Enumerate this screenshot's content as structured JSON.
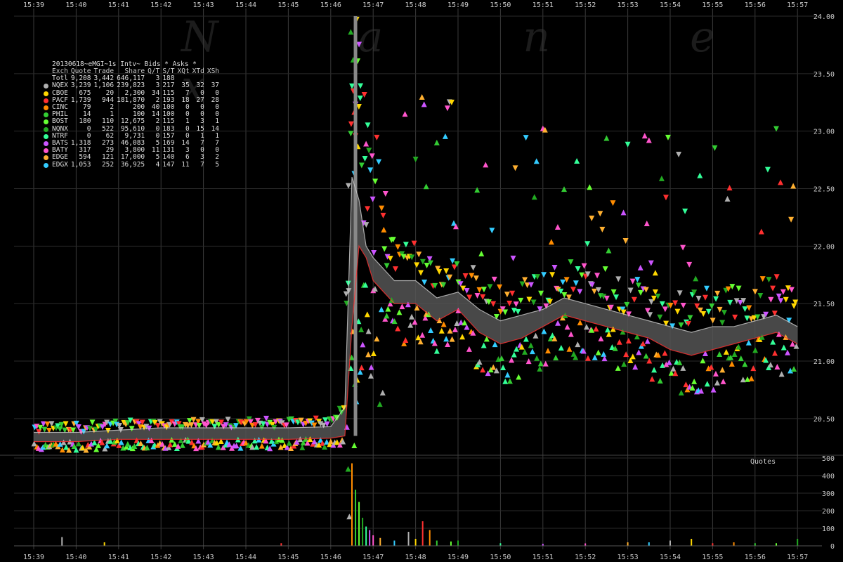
{
  "chart_data": [
    {
      "type": "scatter",
      "title": "20130618~eMGI~1s Intv~ Bids * Asks *",
      "watermark": "N a n e x",
      "x_ticks": [
        "15:39",
        "15:40",
        "15:41",
        "15:42",
        "15:43",
        "15:44",
        "15:45",
        "15:46",
        "15:47",
        "15:48",
        "15:49",
        "15:50",
        "15:51",
        "15:52",
        "15:53",
        "15:54",
        "15:55",
        "15:56",
        "15:57"
      ],
      "y_ticks": [
        "24.00",
        "23.50",
        "23.00",
        "22.50",
        "22.00",
        "21.50",
        "21.00",
        "20.50"
      ],
      "ylim": [
        20.2,
        24.0
      ],
      "grid": true,
      "colors": {
        "NQEX": "#b0b0b0",
        "CBOE": "#ffd700",
        "PACF": "#ff3030",
        "CINC": "#ff8c00",
        "PHIL": "#33cc33",
        "BOST": "#66ff33",
        "NQNX": "#22aa22",
        "NTRF": "#33ff99",
        "BATS": "#cc55ff",
        "BATY": "#ff55cc",
        "EDGE": "#ffb030",
        "EDGX": "#33ccff",
        "nbbo": "#555555"
      },
      "legend": {
        "columns": [
          "Exch",
          "Quote",
          "Trade",
          "Share",
          "Q/T",
          "S/T",
          "XQt",
          "XTd",
          "XSh"
        ],
        "rows": [
          {
            "name": "Totl",
            "color": "",
            "values": [
              "9,208",
              "3,442",
              "646,117",
              "3",
              "188",
              "",
              "",
              ""
            ]
          },
          {
            "name": "NQEX",
            "color": "#b0b0b0",
            "values": [
              "3,239",
              "1,106",
              "239,823",
              "3",
              "217",
              "35",
              "32",
              "37"
            ]
          },
          {
            "name": "CBOE",
            "color": "#ffd700",
            "values": [
              "675",
              "20",
              "2,300",
              "34",
              "115",
              "7",
              "0",
              "0"
            ]
          },
          {
            "name": "PACF",
            "color": "#ff3030",
            "values": [
              "1,739",
              "944",
              "181,870",
              "2",
              "193",
              "18",
              "27",
              "28"
            ]
          },
          {
            "name": "CINC",
            "color": "#ff8c00",
            "values": [
              "79",
              "2",
              "200",
              "40",
              "100",
              "0",
              "0",
              "0"
            ]
          },
          {
            "name": "PHIL",
            "color": "#33cc33",
            "values": [
              "14",
              "1",
              "100",
              "14",
              "100",
              "0",
              "0",
              "0"
            ]
          },
          {
            "name": "BOST",
            "color": "#66ff33",
            "values": [
              "180",
              "110",
              "12,675",
              "2",
              "115",
              "1",
              "3",
              "1"
            ]
          },
          {
            "name": "NQNX",
            "color": "#22aa22",
            "values": [
              "0",
              "522",
              "95,610",
              "0",
              "183",
              "0",
              "15",
              "14"
            ]
          },
          {
            "name": "NTRF",
            "color": "#33ff99",
            "values": [
              "0",
              "62",
              "9,731",
              "0",
              "157",
              "0",
              "1",
              "1"
            ]
          },
          {
            "name": "BATS",
            "color": "#cc55ff",
            "values": [
              "1,318",
              "273",
              "46,083",
              "5",
              "169",
              "14",
              "7",
              "7"
            ]
          },
          {
            "name": "BATY",
            "color": "#ff55cc",
            "values": [
              "317",
              "29",
              "3,800",
              "11",
              "131",
              "3",
              "0",
              "0"
            ]
          },
          {
            "name": "EDGE",
            "color": "#ffb030",
            "values": [
              "594",
              "121",
              "17,000",
              "5",
              "140",
              "6",
              "3",
              "2"
            ]
          },
          {
            "name": "EDGX",
            "color": "#33ccff",
            "values": [
              "1,053",
              "252",
              "36,925",
              "4",
              "147",
              "11",
              "7",
              "5"
            ]
          }
        ]
      },
      "price_path": {
        "x": [
          "15:39:00",
          "15:40:00",
          "15:41:00",
          "15:42:00",
          "15:43:00",
          "15:44:00",
          "15:45:00",
          "15:46:00",
          "15:46:20",
          "15:46:30",
          "15:46:40",
          "15:46:50",
          "15:47:00",
          "15:47:15",
          "15:47:30",
          "15:48:00",
          "15:48:30",
          "15:49:00",
          "15:49:30",
          "15:50:00",
          "15:50:30",
          "15:51:00",
          "15:51:30",
          "15:52:00",
          "15:52:30",
          "15:53:00",
          "15:53:30",
          "15:54:00",
          "15:54:30",
          "15:55:00",
          "15:55:30",
          "15:56:00",
          "15:56:30",
          "15:57:00"
        ],
        "bid": [
          20.3,
          20.3,
          20.32,
          20.32,
          20.32,
          20.32,
          20.32,
          20.33,
          20.35,
          21.3,
          22.0,
          21.9,
          21.7,
          21.6,
          21.5,
          21.5,
          21.35,
          21.45,
          21.25,
          21.15,
          21.2,
          21.3,
          21.4,
          21.35,
          21.3,
          21.25,
          21.2,
          21.1,
          21.05,
          21.1,
          21.15,
          21.2,
          21.25,
          21.15
        ],
        "ask": [
          20.38,
          20.38,
          20.4,
          20.42,
          20.42,
          20.42,
          20.42,
          20.43,
          20.6,
          22.6,
          22.4,
          22.0,
          21.9,
          21.8,
          21.7,
          21.7,
          21.55,
          21.6,
          21.45,
          21.35,
          21.4,
          21.45,
          21.55,
          21.5,
          21.45,
          21.4,
          21.35,
          21.3,
          21.25,
          21.3,
          21.3,
          21.35,
          21.4,
          21.3
        ]
      }
    },
    {
      "type": "bar",
      "title": "Quotes",
      "y_ticks": [
        "500",
        "400",
        "300",
        "200",
        "100",
        "0"
      ],
      "ylim": [
        0,
        500
      ],
      "x": [
        "15:39:40",
        "15:40:40",
        "15:44:50",
        "15:46:30",
        "15:46:35",
        "15:46:40",
        "15:46:45",
        "15:46:50",
        "15:46:55",
        "15:47:00",
        "15:47:10",
        "15:47:30",
        "15:47:50",
        "15:48:00",
        "15:48:10",
        "15:48:20",
        "15:48:30",
        "15:48:50",
        "15:49:00",
        "15:50:00",
        "15:51:00",
        "15:52:00",
        "15:53:00",
        "15:53:30",
        "15:54:00",
        "15:54:30",
        "15:55:00",
        "15:55:30",
        "15:56:00",
        "15:56:30",
        "15:57:00"
      ],
      "values": [
        50,
        20,
        15,
        470,
        320,
        250,
        160,
        110,
        90,
        60,
        45,
        30,
        80,
        40,
        140,
        90,
        30,
        25,
        30,
        15,
        12,
        14,
        20,
        20,
        30,
        40,
        15,
        20,
        15,
        15,
        40
      ]
    }
  ],
  "labels": {
    "quotes": "Quotes"
  }
}
